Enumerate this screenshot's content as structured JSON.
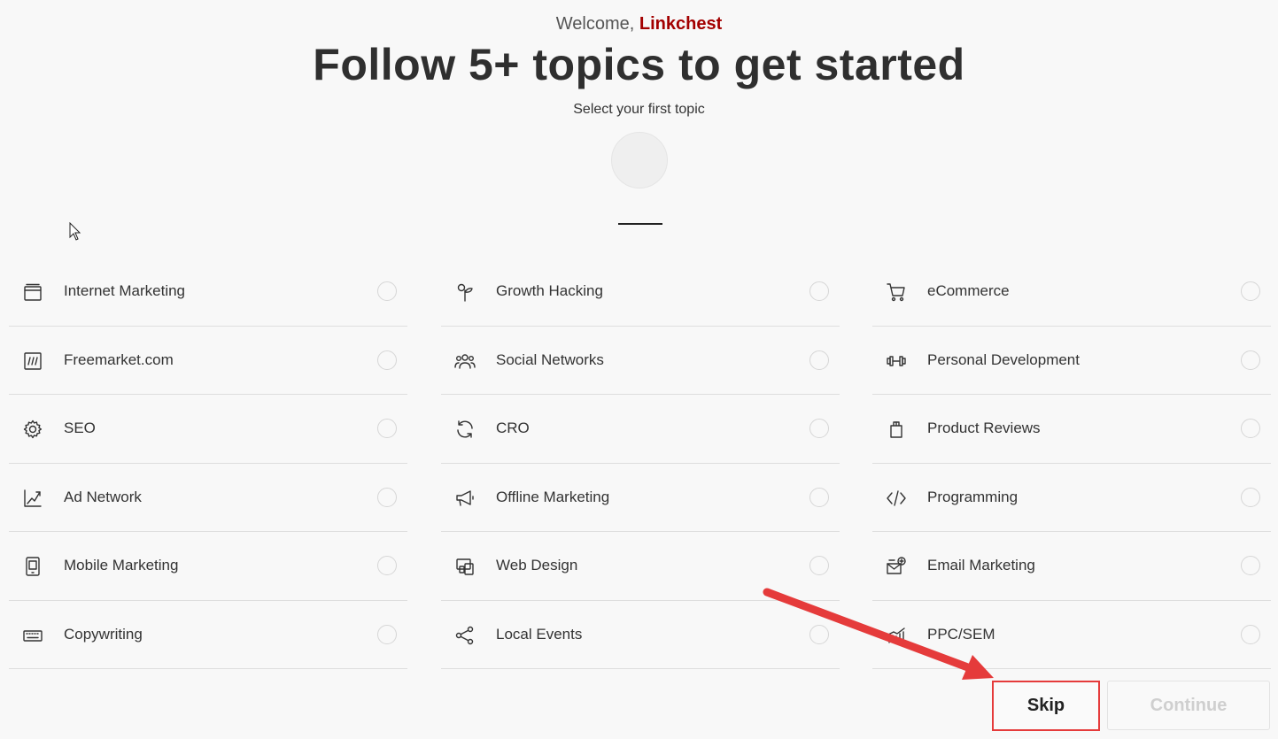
{
  "header": {
    "welcome_prefix": "Welcome,",
    "brand": "Linkchest",
    "title": "Follow 5+ topics to get started",
    "subtitle": "Select your first topic"
  },
  "topics": [
    [
      {
        "label": "Internet Marketing",
        "icon": "browser-window-icon"
      },
      {
        "label": "Freemarket.com",
        "icon": "slash-box-icon"
      },
      {
        "label": "SEO",
        "icon": "gear-icon"
      },
      {
        "label": "Ad Network",
        "icon": "chart-up-icon"
      },
      {
        "label": "Mobile Marketing",
        "icon": "mobile-icon"
      },
      {
        "label": "Copywriting",
        "icon": "keyboard-icon"
      }
    ],
    [
      {
        "label": "Growth Hacking",
        "icon": "sprout-icon"
      },
      {
        "label": "Social Networks",
        "icon": "users-icon"
      },
      {
        "label": "CRO",
        "icon": "refresh-icon"
      },
      {
        "label": "Offline Marketing",
        "icon": "megaphone-icon"
      },
      {
        "label": "Web Design",
        "icon": "devices-icon"
      },
      {
        "label": "Local Events",
        "icon": "share-icon"
      }
    ],
    [
      {
        "label": "eCommerce",
        "icon": "cart-icon"
      },
      {
        "label": "Personal Development",
        "icon": "dumbbell-icon"
      },
      {
        "label": "Product Reviews",
        "icon": "box-icon"
      },
      {
        "label": "Programming",
        "icon": "code-icon"
      },
      {
        "label": "Email Marketing",
        "icon": "email-add-icon"
      },
      {
        "label": "PPC/SEM",
        "icon": "ppc-chart-icon"
      }
    ]
  ],
  "actions": {
    "skip_label": "Skip",
    "continue_label": "Continue"
  },
  "colors": {
    "brand": "#a30000",
    "highlight": "#e53b3b",
    "background": "#f8f8f8"
  }
}
